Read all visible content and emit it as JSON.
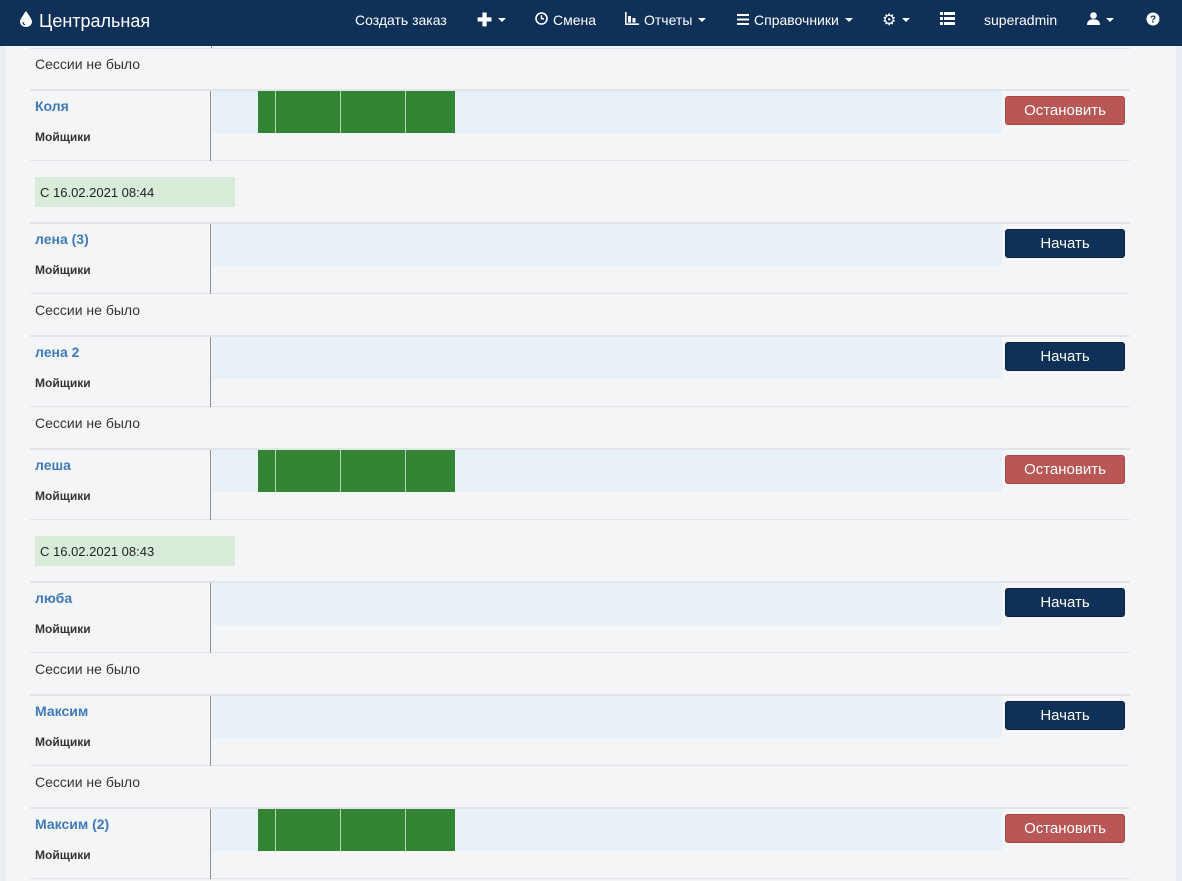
{
  "navbar": {
    "brand": "Центральная",
    "create_order": "Создать заказ",
    "shift": "Смена",
    "reports": "Отчеты",
    "references": "Справочники",
    "username": "superadmin"
  },
  "messages": {
    "no_session": "Сессии не было"
  },
  "employees": [
    {
      "name": "Коля",
      "group": "Мойщики",
      "action": "Остановить"
    },
    {
      "name": "лена (3)",
      "group": "Мойщики",
      "action": "Начать"
    },
    {
      "name": "лена 2",
      "group": "Мойщики",
      "action": "Начать"
    },
    {
      "name": "леша",
      "group": "Мойщики",
      "action": "Остановить"
    },
    {
      "name": "люба",
      "group": "Мойщики",
      "action": "Начать"
    },
    {
      "name": "Максим",
      "group": "Мойщики",
      "action": "Начать"
    },
    {
      "name": "Максим (2)",
      "group": "Мойщики",
      "action": "Остановить"
    }
  ],
  "since_notes": [
    "С 16.02.2021 08:44",
    "С 16.02.2021 08:43"
  ],
  "colors": {
    "navbar": "#0f3057",
    "start_button": "#0f3057",
    "stop_button": "#b85755",
    "session_bar": "#338533",
    "since_background": "#d9ecda",
    "link": "#3f7ab8"
  }
}
